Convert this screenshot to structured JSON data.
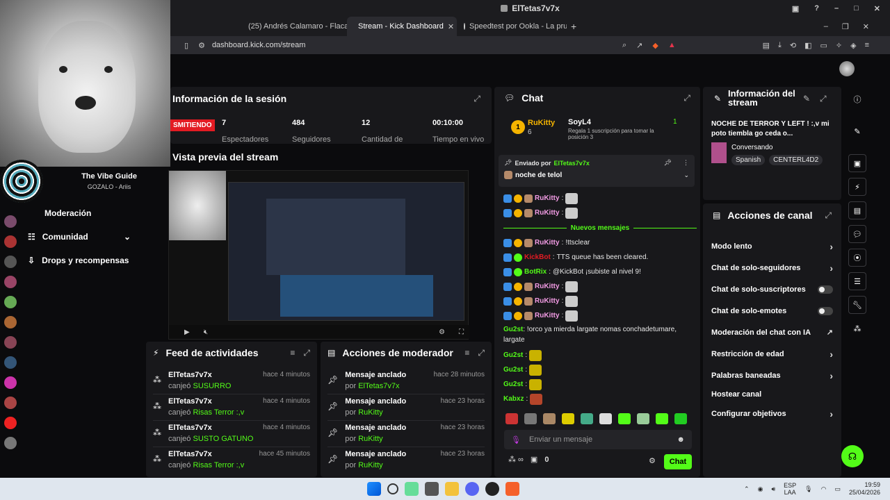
{
  "window": {
    "title": "ElTetas7v7x"
  },
  "tabs": [
    {
      "label": "(25) Andrés Calamaro - Flaca (Videoc"
    },
    {
      "label": "Stream - Kick Dashboard"
    },
    {
      "label": "Speedtest por Ookla - La prueba de"
    }
  ],
  "address": {
    "url": "dashboard.kick.com/stream"
  },
  "webcam": {
    "name": "The Vibe Guide",
    "subtitle": "GOZALO - Ariis"
  },
  "nav": {
    "items": [
      {
        "label": "Moderación"
      },
      {
        "label": "Comunidad"
      },
      {
        "label": "Drops y recompensas"
      }
    ]
  },
  "session": {
    "title": "Información de la sesión",
    "live_badge": "SMITIENDO",
    "stats": [
      {
        "value": "7",
        "label": "Espectadores"
      },
      {
        "value": "484",
        "label": "Seguidores"
      },
      {
        "value": "12",
        "label": "Cantidad de"
      },
      {
        "value": "00:10:00",
        "label": "Tiempo en vivo"
      }
    ]
  },
  "preview": {
    "title": "Vista previa del stream"
  },
  "feed": {
    "title": "Feed de actividades",
    "rows": [
      {
        "name": "ElTetas7v7x",
        "verb": "canjeó",
        "item": "SUSURRO",
        "time": "hace 4 minutos"
      },
      {
        "name": "ElTetas7v7x",
        "verb": "canjeó",
        "item": "Risas Terror :,v",
        "time": "hace 4 minutos"
      },
      {
        "name": "ElTetas7v7x",
        "verb": "canjeó",
        "item": "SUSTO GATUNO",
        "time": "hace 4 minutos"
      },
      {
        "name": "ElTetas7v7x",
        "verb": "canjeó",
        "item": "Risas Terror :,v",
        "time": "hace 45 minutos"
      }
    ]
  },
  "modactions": {
    "title": "Acciones de moderador",
    "rows": [
      {
        "name": "Mensaje anclado",
        "by": "por",
        "user": "ElTetas7v7x",
        "time": "hace 28 minutos"
      },
      {
        "name": "Mensaje anclado",
        "by": "por",
        "user": "RuKitty",
        "time": "hace 23 horas"
      },
      {
        "name": "Mensaje anclado",
        "by": "por",
        "user": "RuKitty",
        "time": "hace 23 horas"
      },
      {
        "name": "Mensaje anclado",
        "by": "por",
        "user": "RuKitty",
        "time": "hace 23 horas"
      }
    ]
  },
  "chat": {
    "title": "Chat",
    "top_user": "RuKitty",
    "top_count": "6",
    "sub_user": "SoyL4",
    "sub_text": "Regala 1 suscripción para tomar la posición 3",
    "sub_count": "1",
    "pinned_label": "Enviado por",
    "pinned_user": "ElTetas7v7x",
    "pinned_text": "noche de telol",
    "new_messages": "Nuevos mensajes",
    "messages": [
      {
        "user": "RuKitty",
        "text": ""
      },
      {
        "user": "RuKitty",
        "text": ""
      },
      {
        "user": "RuKitty",
        "text": "!ttsclear"
      },
      {
        "user": "KickBot",
        "text": "TTS queue has been cleared."
      },
      {
        "user": "BotRix",
        "text": "@KickBot ¡subiste al nivel 9!"
      },
      {
        "user": "RuKitty",
        "text": ""
      },
      {
        "user": "RuKitty",
        "text": ""
      },
      {
        "user": "RuKitty",
        "text": ""
      },
      {
        "user": "Gu2st",
        "text": "!orco ya mierda largate nomas conchadetumare, largate"
      },
      {
        "user": "Gu2st",
        "text": ""
      },
      {
        "user": "Gu2st",
        "text": ""
      },
      {
        "user": "Gu2st",
        "text": ""
      },
      {
        "user": "Kabxz",
        "text": ""
      }
    ],
    "input_placeholder": "Enviar un mensaje",
    "footer_count": "0",
    "send_label": "Chat"
  },
  "streaminfo": {
    "title": "Información del stream",
    "stream_title": "NOCHE DE TERROR Y LEFT ! :,v mi poto tiembla go ceda o...",
    "category": "Conversando",
    "tags": [
      "Spanish",
      "CENTERL4D2"
    ]
  },
  "channelactions": {
    "title": "Acciones de canal",
    "items": [
      {
        "label": "Modo lento",
        "kind": "chevron"
      },
      {
        "label": "Chat de solo-seguidores",
        "kind": "chevron"
      },
      {
        "label": "Chat de solo-suscriptores",
        "kind": "toggle"
      },
      {
        "label": "Chat de solo-emotes",
        "kind": "toggle"
      },
      {
        "label": "Moderación del chat con IA",
        "kind": "external"
      },
      {
        "label": "Restricción de edad",
        "kind": "chevron"
      },
      {
        "label": "Palabras baneadas",
        "kind": "chevron"
      },
      {
        "label": "Hostear canal",
        "kind": "none"
      },
      {
        "label": "Configurar objetivos",
        "kind": "chevron"
      }
    ]
  },
  "taskbar": {
    "lang": "ESP",
    "lang2": "LAA",
    "time": "19:59",
    "date": "25/04/2026"
  },
  "colors": {
    "accent": "#53fc18",
    "panel": "#18181b",
    "bg": "#0b0b0d",
    "live": "#e31b23"
  }
}
